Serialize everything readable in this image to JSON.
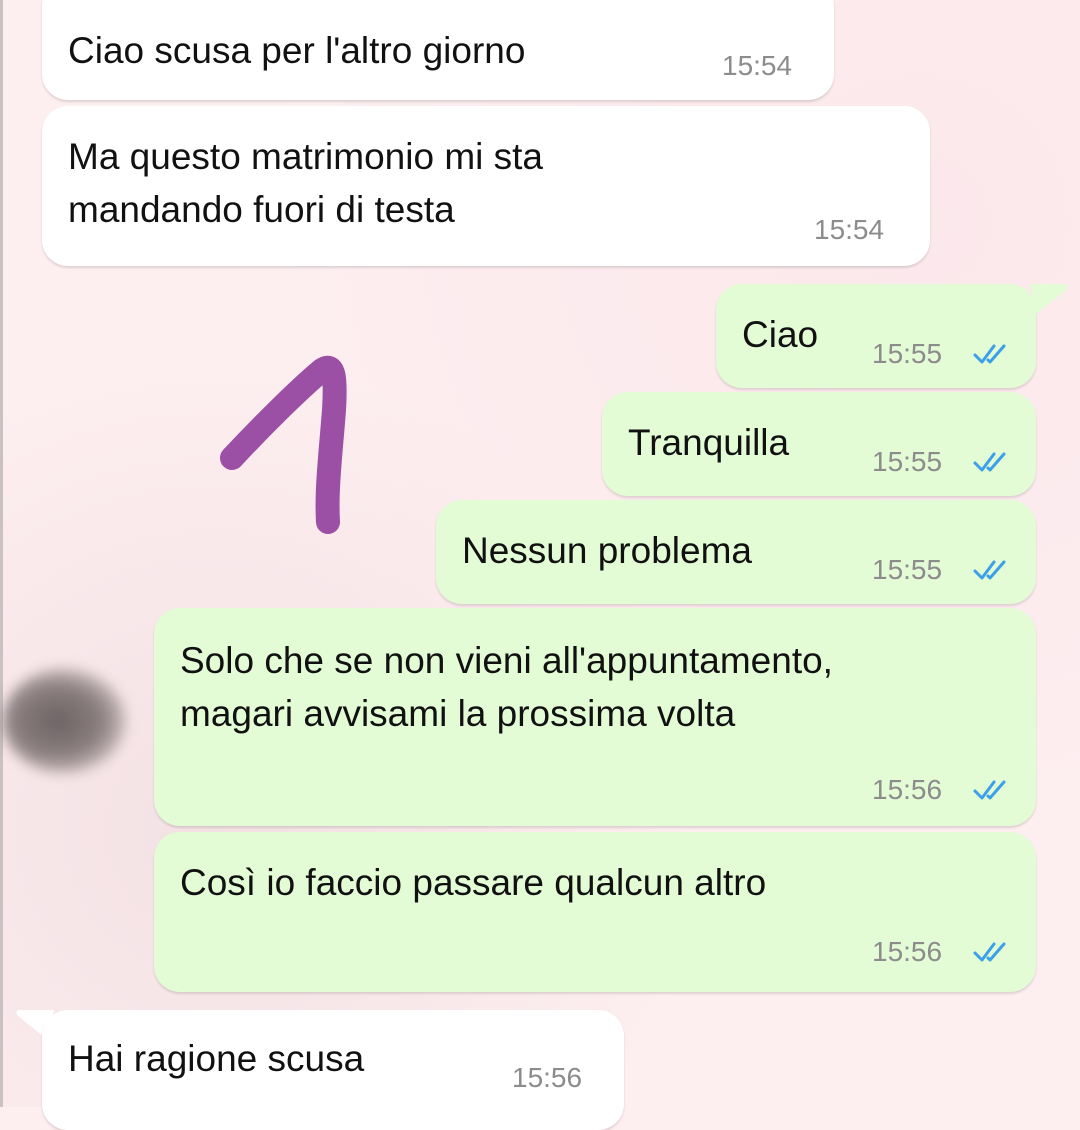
{
  "messages": [
    {
      "direction": "incoming",
      "text": "Ciao scusa per l'altro giorno",
      "time": "15:54"
    },
    {
      "direction": "incoming",
      "text": "Ma questo matrimonio mi sta\nmandando fuori di testa",
      "time": "15:54"
    },
    {
      "direction": "outgoing",
      "text": "Ciao",
      "time": "15:55",
      "status": "read"
    },
    {
      "direction": "outgoing",
      "text": "Tranquilla",
      "time": "15:55",
      "status": "read"
    },
    {
      "direction": "outgoing",
      "text": "Nessun problema",
      "time": "15:55",
      "status": "read"
    },
    {
      "direction": "outgoing",
      "text": "Solo che se non vieni all'appuntamento,\nmagari avvisami la prossima volta",
      "time": "15:56",
      "status": "read"
    },
    {
      "direction": "outgoing",
      "text": "Così io faccio passare qualcun altro",
      "time": "15:56",
      "status": "read"
    },
    {
      "direction": "incoming",
      "text": "Hai ragione scusa",
      "time": "15:56"
    }
  ],
  "colors": {
    "incoming_bubble": "#ffffff",
    "outgoing_bubble": "#e3fcd6",
    "read_ticks": "#3aa0e8",
    "annotation_stroke": "#9b4fa5",
    "chat_background": "#fdeef0"
  },
  "icons": {
    "read_status": "double-check-icon",
    "annotation": "hand-drawn-number-1"
  }
}
